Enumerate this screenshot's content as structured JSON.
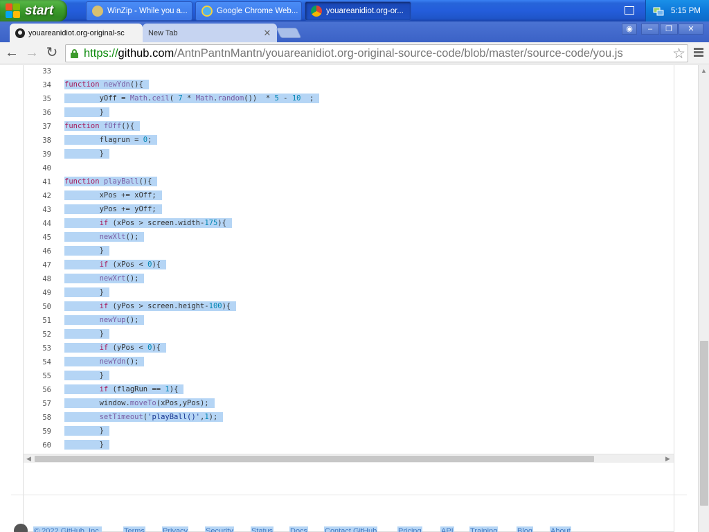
{
  "taskbar": {
    "start_label": "start",
    "tasks": [
      {
        "label": "WinZip - While you a...",
        "icon": "winzip-icon"
      },
      {
        "label": "Google Chrome Web...",
        "icon": "ie-icon"
      },
      {
        "label": "youareanidiot.org-or...",
        "icon": "chrome-icon"
      }
    ],
    "clock": "5:15 PM"
  },
  "browser": {
    "tabs": [
      {
        "label": "youareanidiot.org-original-sc",
        "icon": "github-icon",
        "active": true
      },
      {
        "label": "New Tab",
        "active": false
      }
    ],
    "url": {
      "scheme": "https://",
      "host": "github.com",
      "path": "/AntnPantnMantn/youareanidiot.org-original-source-code/blob/master/source-code/you.js"
    }
  },
  "code": {
    "lines": [
      {
        "n": "33",
        "t": ""
      },
      {
        "n": "34",
        "t": "function newYdn(){"
      },
      {
        "n": "35",
        "t": "        yOff = Math.ceil( 7 * Math.random())  * 5 - 10  ;"
      },
      {
        "n": "36",
        "t": "        }"
      },
      {
        "n": "37",
        "t": "function fOff(){"
      },
      {
        "n": "38",
        "t": "        flagrun = 0;"
      },
      {
        "n": "39",
        "t": "        }"
      },
      {
        "n": "40",
        "t": ""
      },
      {
        "n": "41",
        "t": "function playBall(){"
      },
      {
        "n": "42",
        "t": "        xPos += xOff;"
      },
      {
        "n": "43",
        "t": "        yPos += yOff;"
      },
      {
        "n": "44",
        "t": "        if (xPos > screen.width-175){"
      },
      {
        "n": "45",
        "t": "        newXlt();"
      },
      {
        "n": "46",
        "t": "        }"
      },
      {
        "n": "47",
        "t": "        if (xPos < 0){"
      },
      {
        "n": "48",
        "t": "        newXrt();"
      },
      {
        "n": "49",
        "t": "        }"
      },
      {
        "n": "50",
        "t": "        if (yPos > screen.height-100){"
      },
      {
        "n": "51",
        "t": "        newYup();"
      },
      {
        "n": "52",
        "t": "        }"
      },
      {
        "n": "53",
        "t": "        if (yPos < 0){"
      },
      {
        "n": "54",
        "t": "        newYdn();"
      },
      {
        "n": "55",
        "t": "        }"
      },
      {
        "n": "56",
        "t": "        if (flagRun == 1){"
      },
      {
        "n": "57",
        "t": "        window.moveTo(xPos,yPos);"
      },
      {
        "n": "58",
        "t": "        setTimeout('playBall()',1);"
      },
      {
        "n": "59",
        "t": "        }"
      },
      {
        "n": "60",
        "t": "        }"
      }
    ]
  },
  "footer": {
    "links": [
      "© 2022 GitHub, Inc.",
      "Terms",
      "Privacy",
      "Security",
      "Status",
      "Docs",
      "Contact GitHub",
      "Pricing",
      "API",
      "Training",
      "Blog",
      "About"
    ]
  },
  "colors": {
    "selection": "#b5d5f5",
    "keyword": "#a71d5d",
    "function": "#795da3",
    "number": "#0086b3",
    "string": "#183691",
    "url_scheme": "#0a8a0a"
  }
}
